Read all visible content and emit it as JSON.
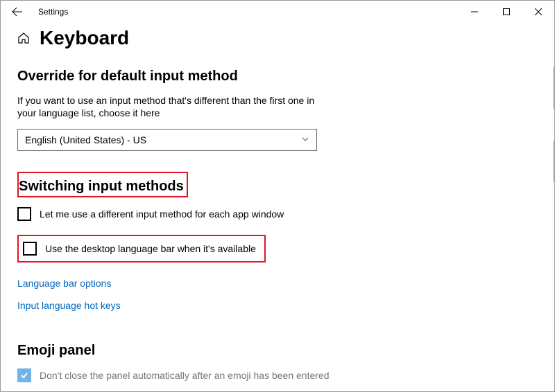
{
  "titlebar": {
    "title": "Settings"
  },
  "page": {
    "title": "Keyboard"
  },
  "override": {
    "heading": "Override for default input method",
    "help": "If you want to use an input method that's different than the first one in your language list, choose it here",
    "selected": "English (United States) - US"
  },
  "switching": {
    "heading": "Switching input methods",
    "cb1_label": "Let me use a different input method for each app window",
    "cb2_label": "Use the desktop language bar when it's available",
    "link1": "Language bar options",
    "link2": "Input language hot keys"
  },
  "emoji": {
    "heading": "Emoji panel",
    "cb_label": "Don't close the panel automatically after an emoji has been entered"
  }
}
